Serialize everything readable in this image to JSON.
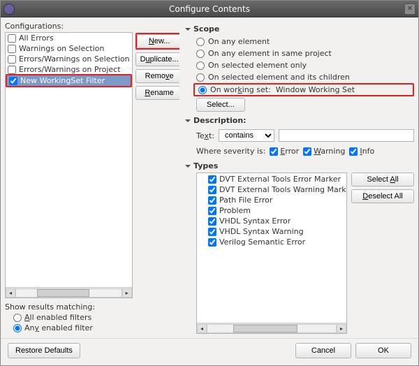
{
  "window": {
    "title": "Configure Contents"
  },
  "left": {
    "label": "Configurations:",
    "items": [
      {
        "checked": false,
        "label": "All Errors"
      },
      {
        "checked": false,
        "label": "Warnings on Selection"
      },
      {
        "checked": false,
        "label": "Errors/Warnings on Selection"
      },
      {
        "checked": false,
        "label": "Errors/Warnings on Project"
      },
      {
        "checked": true,
        "label": "New WorkingSet Filter",
        "selected": true
      }
    ],
    "buttons": {
      "new": "New...",
      "duplicate": "Duplicate...",
      "remove": "Remove",
      "rename": "Rename"
    },
    "matching": {
      "label": "Show results matching:",
      "all": "All enabled filters",
      "any": "Any enabled filter",
      "value": "any"
    }
  },
  "scope": {
    "title": "Scope",
    "options": {
      "any": "On any element",
      "same_project": "On any element in same project",
      "selected_only": "On selected element only",
      "selected_children": "On selected element and its children",
      "working_set": "On working set:  Window Working Set"
    },
    "value": "working_set",
    "select_btn": "Select..."
  },
  "description": {
    "title": "Description:",
    "text_label": "Text:",
    "combo_value": "contains",
    "text_value": "",
    "severity_label": "Where severity is:",
    "sev": {
      "error": {
        "label": "Error",
        "checked": true
      },
      "warning": {
        "label": "Warning",
        "checked": true
      },
      "info": {
        "label": "Info",
        "checked": true
      }
    }
  },
  "types": {
    "title": "Types",
    "items": [
      {
        "checked": true,
        "label": "DVT External Tools Error Marker"
      },
      {
        "checked": true,
        "label": "DVT External Tools Warning Marker"
      },
      {
        "checked": true,
        "label": "Path File Error"
      },
      {
        "checked": true,
        "label": "Problem"
      },
      {
        "checked": true,
        "label": "VHDL Syntax Error"
      },
      {
        "checked": true,
        "label": "VHDL Syntax Warning"
      },
      {
        "checked": true,
        "label": "Verilog Semantic Error"
      }
    ],
    "select_all": "Select All",
    "deselect_all": "Deselect All"
  },
  "footer": {
    "restore": "Restore Defaults",
    "cancel": "Cancel",
    "ok": "OK"
  }
}
